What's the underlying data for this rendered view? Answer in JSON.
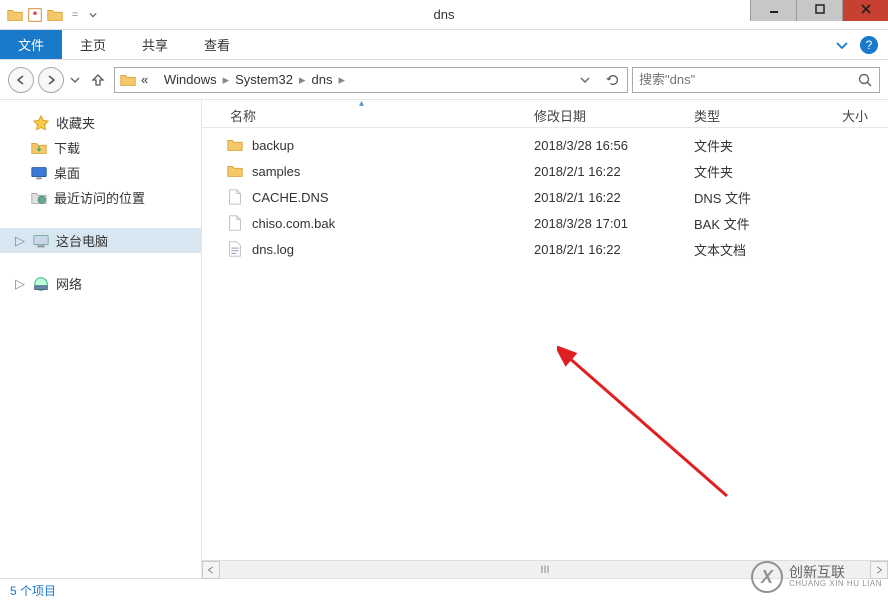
{
  "window": {
    "title": "dns"
  },
  "ribbon": {
    "file_tab": "文件",
    "tabs": [
      "主页",
      "共享",
      "查看"
    ]
  },
  "nav": {
    "crumbs_prefix": "«",
    "crumbs": [
      "Windows",
      "System32",
      "dns"
    ],
    "search_placeholder": "搜索\"dns\""
  },
  "sidebar": {
    "favorites": {
      "label": "收藏夹",
      "items": [
        "下载",
        "桌面",
        "最近访问的位置"
      ]
    },
    "computer": {
      "label": "这台电脑"
    },
    "network": {
      "label": "网络"
    }
  },
  "columns": {
    "name": "名称",
    "date": "修改日期",
    "type": "类型",
    "size": "大小"
  },
  "files": [
    {
      "icon": "folder",
      "name": "backup",
      "date": "2018/3/28 16:56",
      "type": "文件夹"
    },
    {
      "icon": "folder",
      "name": "samples",
      "date": "2018/2/1 16:22",
      "type": "文件夹"
    },
    {
      "icon": "file",
      "name": "CACHE.DNS",
      "date": "2018/2/1 16:22",
      "type": "DNS 文件"
    },
    {
      "icon": "file",
      "name": "chiso.com.bak",
      "date": "2018/3/28 17:01",
      "type": "BAK 文件"
    },
    {
      "icon": "text",
      "name": "dns.log",
      "date": "2018/2/1 16:22",
      "type": "文本文档"
    }
  ],
  "status": {
    "item_count": "5 个项目"
  },
  "watermark": {
    "brand": "创新互联",
    "sub": "CHUANG XIN HU LIAN"
  },
  "scroll_thumb": "III"
}
